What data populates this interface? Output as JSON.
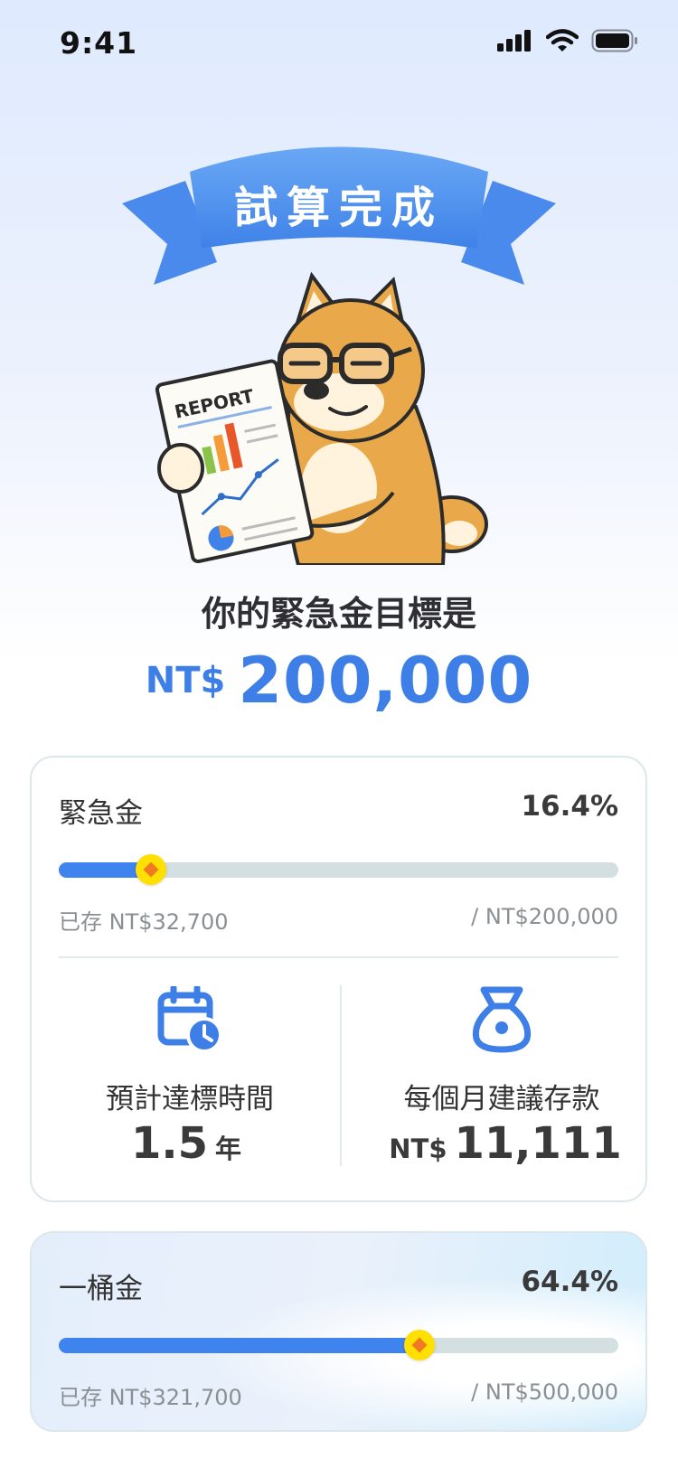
{
  "status_bar": {
    "time": "9:41"
  },
  "ribbon": {
    "title": "試算完成"
  },
  "illustration": {
    "report_label": "REPORT"
  },
  "goal": {
    "label": "你的緊急金目標是",
    "currency": "NT$",
    "amount": "200,000"
  },
  "emergency": {
    "title": "緊急金",
    "percent": "16.4%",
    "progress": 0.164,
    "saved": "已存 NT$32,700",
    "target": "/ NT$200,000",
    "eta_label": "預計達標時間",
    "eta_value": "1.5",
    "eta_unit": "年",
    "monthly_label": "每個月建議存款",
    "monthly_currency": "NT$",
    "monthly_value": "11,111"
  },
  "bucket": {
    "title": "一桶金",
    "percent": "64.4%",
    "progress": 0.644,
    "saved": "已存 NT$321,700",
    "target": "/ NT$500,000"
  },
  "colors": {
    "accent": "#3d7fe6",
    "track": "#d3dfe0",
    "knob": "#ffe000",
    "knob_diamond": "#f07a21",
    "dog": "#e9a94b"
  }
}
